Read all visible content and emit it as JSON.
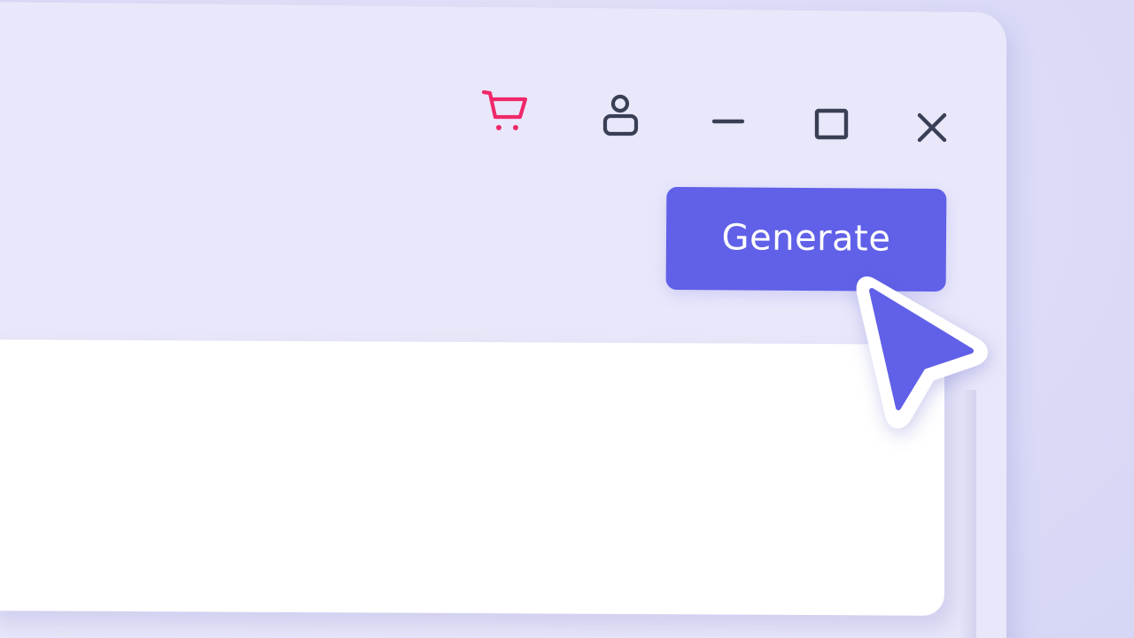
{
  "window": {
    "controls": {
      "cart_icon": "cart-icon",
      "account_icon": "account-icon",
      "minimize_icon": "minimize-icon",
      "maximize_icon": "maximize-icon",
      "close_icon": "close-icon"
    }
  },
  "toolbar": {
    "generate_label": "Generate"
  },
  "colors": {
    "background": "#dcdcf8",
    "window": "#e9e8fa",
    "accent": "#6060e8",
    "cart": "#f0286a",
    "icon_dark": "#3a3f55",
    "panel": "#ffffff"
  }
}
